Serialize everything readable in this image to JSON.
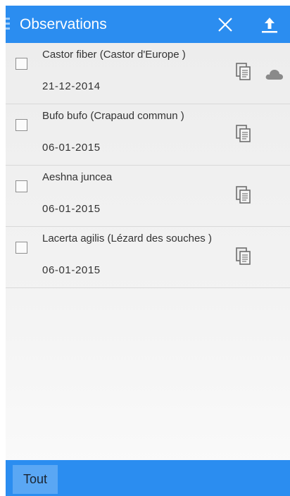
{
  "header": {
    "title": "Observations",
    "menu_icon": "menu-icon",
    "close_icon": "close-icon",
    "upload_icon": "upload-icon"
  },
  "observations": [
    {
      "name": "Castor fiber (Castor d'Europe )",
      "date": "21-12-2014",
      "synced": false,
      "icons": [
        "copy-icon",
        "cloud-icon"
      ]
    },
    {
      "name": "Bufo bufo (Crapaud commun )",
      "date": "06-01-2015",
      "icons": [
        "copy-icon"
      ]
    },
    {
      "name": "Aeshna juncea",
      "date": "06-01-2015",
      "icons": [
        "copy-icon"
      ]
    },
    {
      "name": "Lacerta agilis (Lézard des souches )",
      "date": "06-01-2015",
      "icons": [
        "copy-icon"
      ]
    }
  ],
  "footer": {
    "select_all_label": "Tout"
  },
  "colors": {
    "primary": "#2b8df0",
    "button": "#5aa7f4",
    "text": "#333333"
  }
}
